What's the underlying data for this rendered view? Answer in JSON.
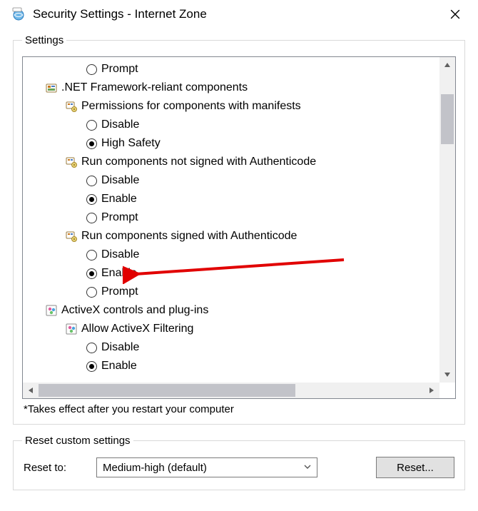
{
  "window": {
    "title": "Security Settings - Internet Zone"
  },
  "settings": {
    "legend": "Settings",
    "footnote": "*Takes effect after you restart your computer",
    "tree": [
      {
        "kind": "option",
        "indent": 3,
        "label": "Prompt",
        "selected": false
      },
      {
        "kind": "category",
        "indent": 1,
        "icon": "dotnet-icon",
        "label": ".NET Framework-reliant components"
      },
      {
        "kind": "category",
        "indent": 2,
        "icon": "component-icon",
        "label": "Permissions for components with manifests"
      },
      {
        "kind": "option",
        "indent": 3,
        "label": "Disable",
        "selected": false
      },
      {
        "kind": "option",
        "indent": 3,
        "label": "High Safety",
        "selected": true
      },
      {
        "kind": "category",
        "indent": 2,
        "icon": "component-icon",
        "label": "Run components not signed with Authenticode"
      },
      {
        "kind": "option",
        "indent": 3,
        "label": "Disable",
        "selected": false
      },
      {
        "kind": "option",
        "indent": 3,
        "label": "Enable",
        "selected": true
      },
      {
        "kind": "option",
        "indent": 3,
        "label": "Prompt",
        "selected": false
      },
      {
        "kind": "category",
        "indent": 2,
        "icon": "component-icon",
        "label": "Run components signed with Authenticode"
      },
      {
        "kind": "option",
        "indent": 3,
        "label": "Disable",
        "selected": false
      },
      {
        "kind": "option",
        "indent": 3,
        "label": "Enable",
        "selected": true,
        "highlight": true
      },
      {
        "kind": "option",
        "indent": 3,
        "label": "Prompt",
        "selected": false
      },
      {
        "kind": "category",
        "indent": 1,
        "icon": "activex-icon",
        "label": "ActiveX controls and plug-ins"
      },
      {
        "kind": "category",
        "indent": 2,
        "icon": "activex-icon",
        "label": "Allow ActiveX Filtering"
      },
      {
        "kind": "option",
        "indent": 3,
        "label": "Disable",
        "selected": false
      },
      {
        "kind": "option",
        "indent": 3,
        "label": "Enable",
        "selected": true
      }
    ]
  },
  "reset": {
    "legend": "Reset custom settings",
    "label": "Reset to:",
    "selected": "Medium-high (default)",
    "button": "Reset..."
  },
  "annotation": {
    "arrow_color": "#e10000"
  }
}
